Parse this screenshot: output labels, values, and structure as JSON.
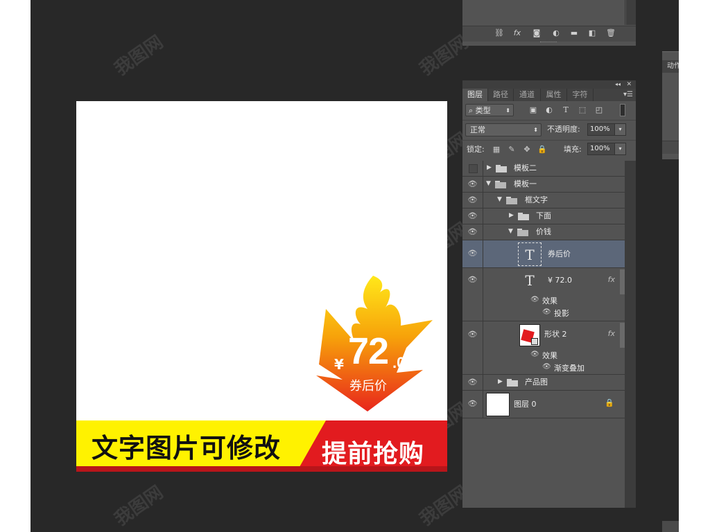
{
  "watermark": "我图网",
  "toppanel": {
    "icons": [
      "link-icon",
      "fx-icon",
      "mask-icon",
      "adjustment-icon",
      "folder-icon",
      "new-layer-icon",
      "trash-icon"
    ],
    "fx_label": "fx"
  },
  "rightpanel": {
    "header": "动作"
  },
  "layers_panel": {
    "tabs": [
      {
        "label": "图层",
        "active": true
      },
      {
        "label": "路径",
        "active": false
      },
      {
        "label": "通道",
        "active": false
      },
      {
        "label": "属性",
        "active": false
      },
      {
        "label": "字符",
        "active": false
      }
    ],
    "filter_type": "类型",
    "blend_mode": "正常",
    "opacity_label": "不透明度:",
    "opacity_value": "100%",
    "lock_label": "锁定:",
    "fill_label": "填充:",
    "fill_value": "100%",
    "text_thumb": "T",
    "layers": [
      {
        "name": "模板二"
      },
      {
        "name": "模板一"
      },
      {
        "name": "框文字"
      },
      {
        "name": "下面"
      },
      {
        "name": "价钱"
      },
      {
        "name": "券后价"
      },
      {
        "name": "¥ 72.0",
        "fx": "fx",
        "effects_label": "效果",
        "effects": [
          "投影"
        ]
      },
      {
        "name": "形状 2",
        "fx": "fx",
        "effects_label": "效果",
        "effects": [
          "渐变叠加"
        ]
      },
      {
        "name": "产品图"
      },
      {
        "name": "图层 0"
      }
    ]
  },
  "canvas": {
    "price_currency": "¥",
    "price_int": "72",
    "price_dec": ".0",
    "price_label": "券后价",
    "banner_left": "文字图片可修改",
    "banner_right": "提前抢购",
    "colors": {
      "yellow": "#fff200",
      "red": "#e21b1f",
      "flame_top": "#ffd400",
      "flame_bottom": "#e8261c"
    }
  }
}
